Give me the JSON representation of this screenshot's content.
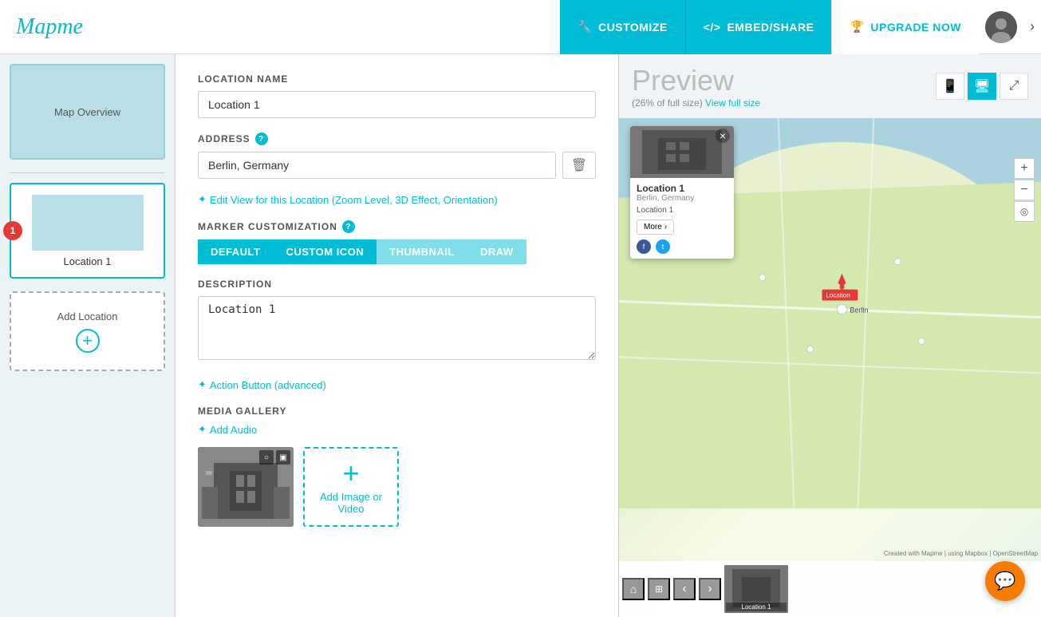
{
  "header": {
    "logo": "Mapme",
    "customize_label": "CUSTOMIZE",
    "embed_label": "EMBED/SHARE",
    "upgrade_label": "UPGRADE NOW"
  },
  "sidebar": {
    "map_overview_label": "Map Overview",
    "location_item_label": "Location 1",
    "location_item_number": "1",
    "add_location_label": "Add Location"
  },
  "form": {
    "location_name_label": "LOCATION NAME",
    "location_name_value": "Location 1",
    "address_label": "ADDRESS",
    "address_value": "Berlin, Germany",
    "edit_view_link": "Edit View for this Location (Zoom Level, 3D Effect, Orientation)",
    "marker_customization_label": "MARKER CUSTOMIZATION",
    "marker_tabs": [
      {
        "label": "DEFAULT",
        "active": true
      },
      {
        "label": "CUSTOM ICON",
        "active": false
      },
      {
        "label": "THUMBNAIL",
        "active": false
      },
      {
        "label": "DRAW",
        "active": false
      }
    ],
    "description_label": "DESCRIPTION",
    "description_value": "Location 1",
    "action_button_link": "Action Button (advanced)",
    "media_gallery_label": "MEDIA GALLERY",
    "add_audio_link": "Add Audio",
    "add_media_label": "Add Image or\nVideo"
  },
  "preview": {
    "title": "Preview",
    "subtitle": "(26% of full size)",
    "view_full_size": "View full size",
    "view_modes": [
      "mobile",
      "desktop",
      "fullscreen"
    ],
    "popup": {
      "title": "Location 1",
      "address": "Berlin, Germany",
      "description": "Location 1",
      "more_btn": "More",
      "close": "×"
    },
    "map_controls": [
      "+",
      "−",
      "◎"
    ],
    "thumb_nav_left": "‹",
    "thumb_nav_right": "›",
    "thumb_home": "⌂",
    "thumb_label": "Location 1",
    "credit": "Created with Mapme | using Mapbox | OpenStreetMap"
  },
  "chat": {
    "icon": "💬"
  }
}
